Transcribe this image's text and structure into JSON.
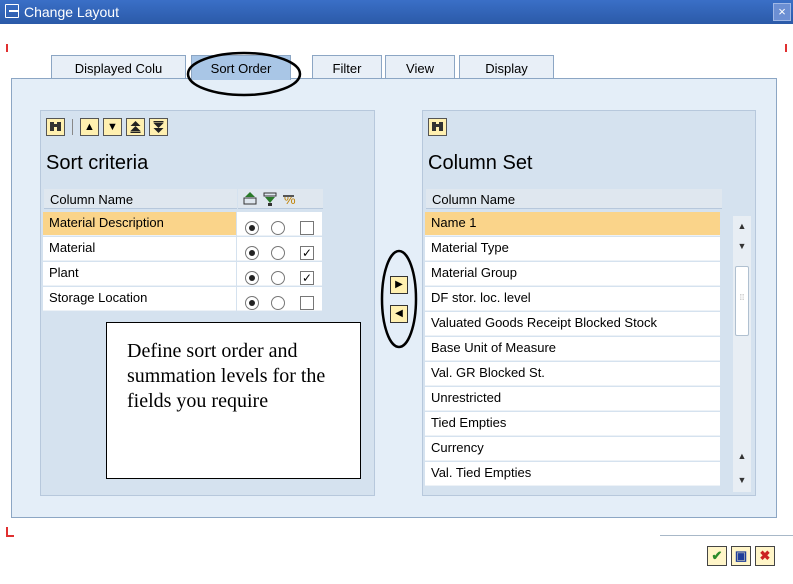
{
  "window": {
    "title": "Change Layout",
    "close_symbol": "×"
  },
  "tabs": [
    {
      "label": "Displayed Colu",
      "active": false
    },
    {
      "label": "Sort Order",
      "active": true
    },
    {
      "label": "Filter",
      "active": false
    },
    {
      "label": "View",
      "active": false
    },
    {
      "label": "Display",
      "active": false
    }
  ],
  "sort_panel": {
    "toolbar_icons": [
      "find-icon",
      "move-up-icon",
      "move-down-icon",
      "move-top-icon",
      "move-bottom-icon"
    ],
    "title": "Sort criteria",
    "column_header": "Column Name",
    "header_icons": [
      "ascending-icon",
      "descending-icon",
      "subtotal-icon"
    ],
    "rows": [
      {
        "name": "Material Description",
        "ascending": true,
        "subtotal": false,
        "selected": true
      },
      {
        "name": "Material",
        "ascending": true,
        "subtotal": true,
        "selected": false
      },
      {
        "name": "Plant",
        "ascending": true,
        "subtotal": true,
        "selected": false
      },
      {
        "name": "Storage Location",
        "ascending": true,
        "subtotal": false,
        "selected": false
      }
    ],
    "check_mark": "✓"
  },
  "column_set_panel": {
    "title": "Column Set",
    "column_header": "Column Name",
    "rows": [
      "Name 1",
      "Material Type",
      "Material Group",
      "DF stor. loc. level",
      "Valuated Goods Receipt Blocked Stock",
      "Base Unit of Measure",
      "Val. GR Blocked St.",
      "Unrestricted",
      "Tied Empties",
      "Currency",
      "Val. Tied Empties"
    ],
    "selected_index": 0
  },
  "move_buttons": {
    "add": "▶",
    "remove": "◀"
  },
  "annotation": {
    "text": "Define sort order and summation levels for the fields you require"
  },
  "footer_buttons": [
    {
      "name": "confirm-button",
      "symbol": "✔",
      "color": "#2a8a2a"
    },
    {
      "name": "save-button",
      "symbol": "▣",
      "color": "#1f3e9a"
    },
    {
      "name": "cancel-button",
      "symbol": "✖",
      "color": "#cc2222"
    }
  ]
}
